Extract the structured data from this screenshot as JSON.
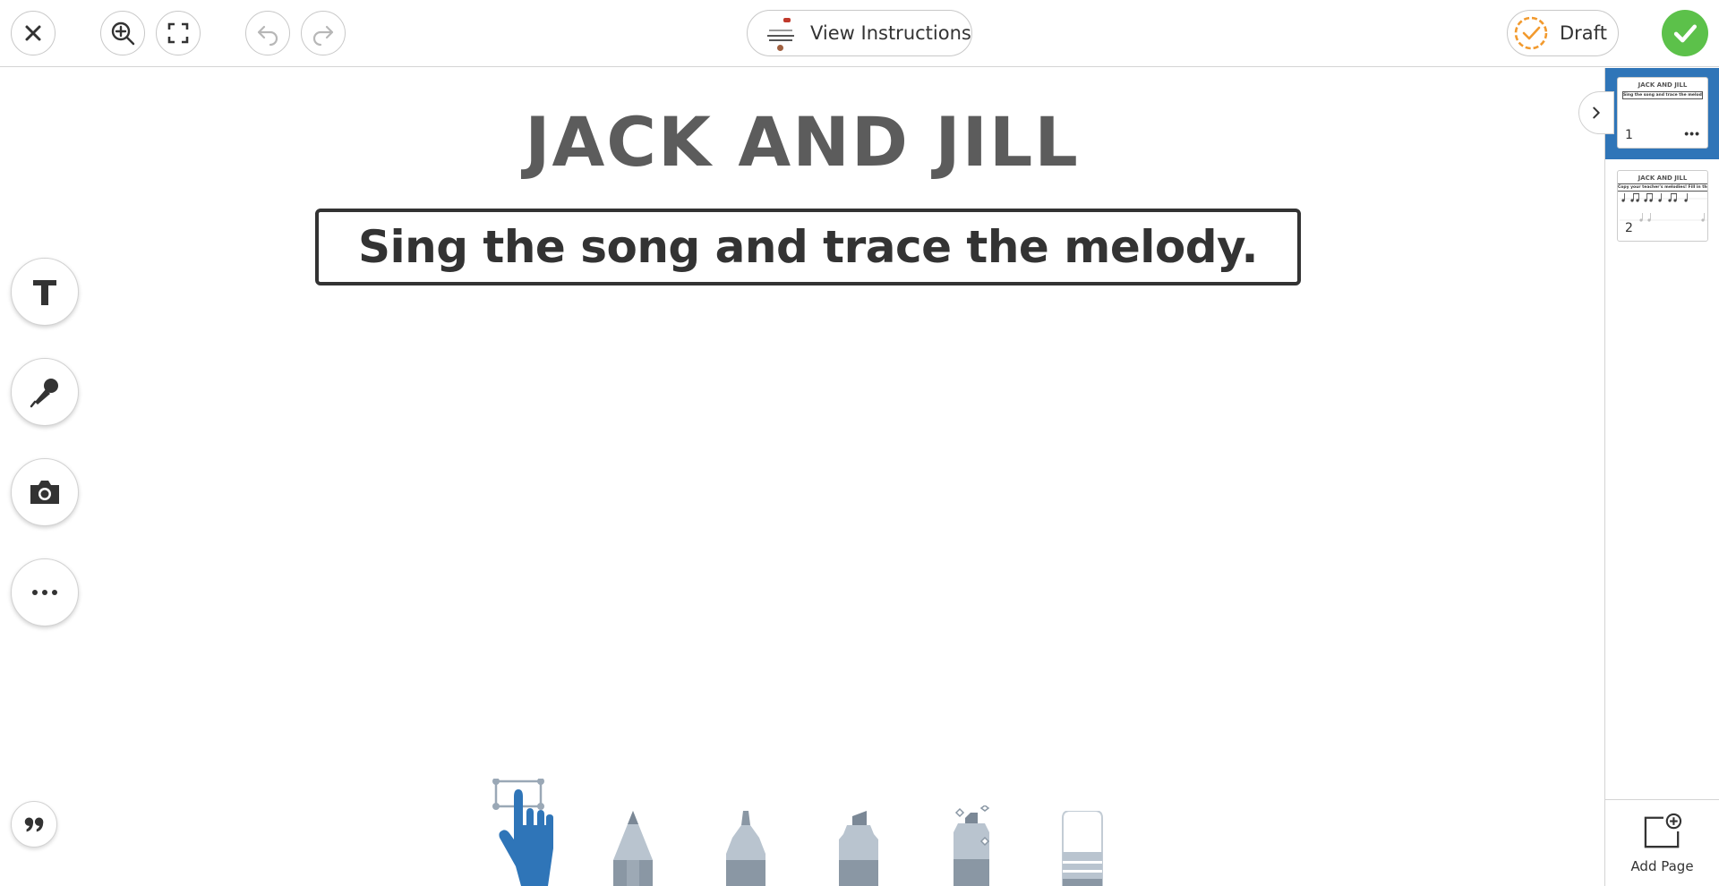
{
  "toolbar": {
    "close_icon": "close-icon",
    "zoom_icon": "zoom-in-icon",
    "fullscreen_icon": "fullscreen-icon",
    "undo_icon": "undo-icon",
    "redo_icon": "redo-icon",
    "instructions_label": "View Instructions",
    "status_label": "Draft",
    "done_icon": "check-icon",
    "status_color": "#f29a2e",
    "done_color": "#5cc14a"
  },
  "page": {
    "title": "JACK AND JILL",
    "instruction": "Sing the song and trace the melody."
  },
  "side_tools": [
    "text-tool",
    "microphone-tool",
    "camera-tool",
    "more-tool"
  ],
  "tray": [
    "select-hand",
    "pencil",
    "marker",
    "highlighter",
    "magic-pen",
    "eraser"
  ],
  "pages": [
    {
      "number": "1",
      "title": "JACK AND JILL",
      "instruction": "Sing the song and trace the melody.",
      "more": "•••",
      "active": true
    },
    {
      "number": "2",
      "title": "JACK AND JILL",
      "instruction": "Copy your teacher's melodies! Fill in the missing notes",
      "active": false
    }
  ],
  "add_page_label": "Add Page",
  "accent_color": "#2f75b8"
}
